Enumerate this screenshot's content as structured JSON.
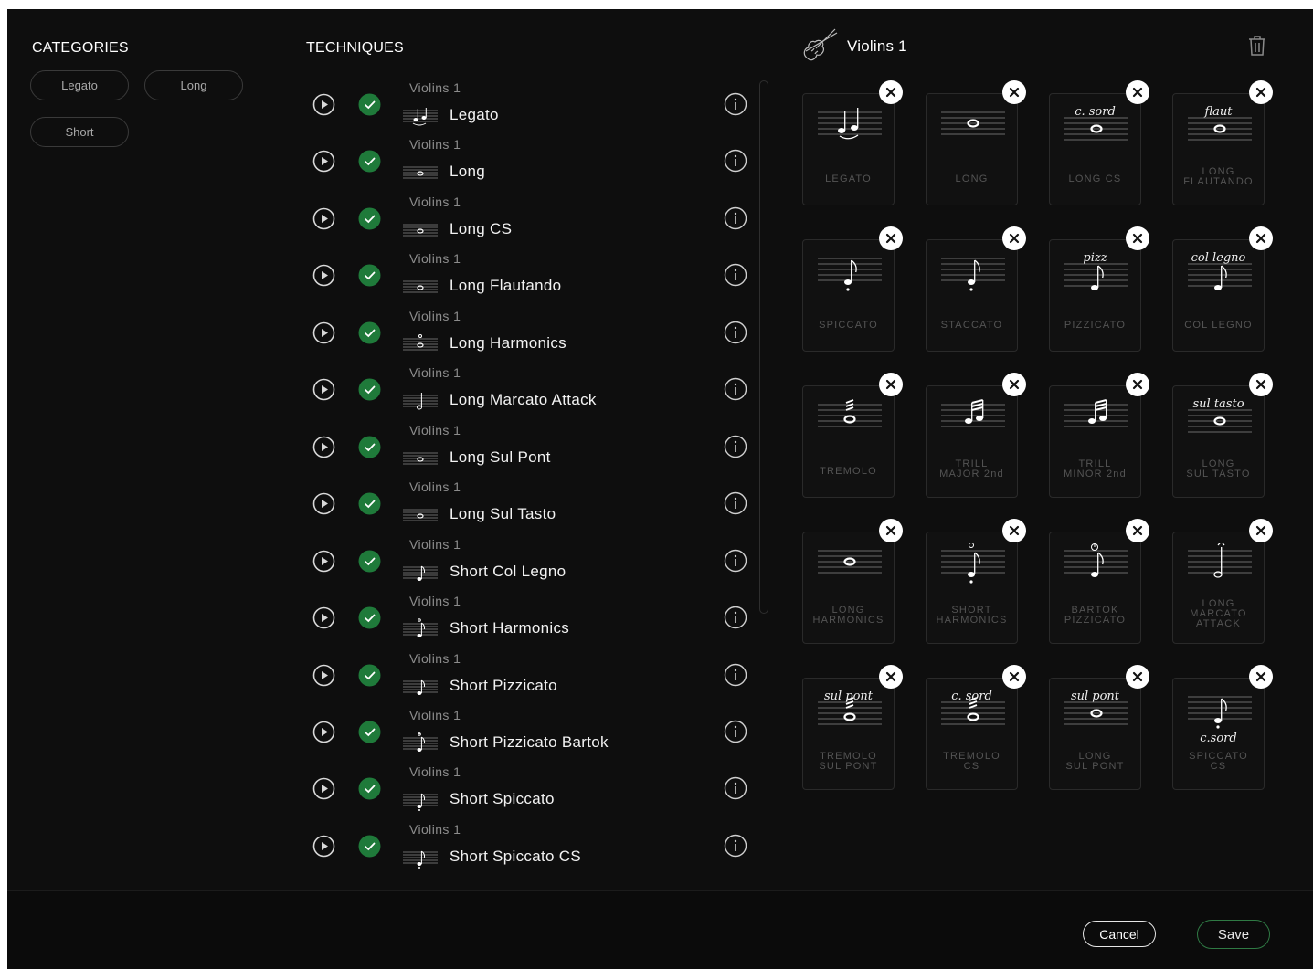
{
  "categories": {
    "title": "CATEGORIES",
    "items": [
      "Legato",
      "Long",
      "Short"
    ]
  },
  "techniques": {
    "title": "TECHNIQUES",
    "rows": [
      {
        "instrument": "Violins 1",
        "name": "Legato",
        "icon": "legato-notation-icon",
        "enabled": true
      },
      {
        "instrument": "Violins 1",
        "name": "Long",
        "icon": "whole-note-icon",
        "enabled": true
      },
      {
        "instrument": "Violins 1",
        "name": "Long CS",
        "icon": "con-sordino-whole-note-icon",
        "enabled": true
      },
      {
        "instrument": "Violins 1",
        "name": "Long Flautando",
        "icon": "flautando-whole-note-icon",
        "enabled": true
      },
      {
        "instrument": "Violins 1",
        "name": "Long Harmonics",
        "icon": "harmonic-whole-note-icon",
        "enabled": true
      },
      {
        "instrument": "Violins 1",
        "name": "Long Marcato Attack",
        "icon": "marcato-note-icon",
        "enabled": true
      },
      {
        "instrument": "Violins 1",
        "name": "Long Sul Pont",
        "icon": "sul-pont-whole-note-icon",
        "enabled": true
      },
      {
        "instrument": "Violins 1",
        "name": "Long Sul Tasto",
        "icon": "sul-tasto-whole-note-icon",
        "enabled": true
      },
      {
        "instrument": "Violins 1",
        "name": "Short Col Legno",
        "icon": "col-legno-eighth-note-icon",
        "enabled": true
      },
      {
        "instrument": "Violins 1",
        "name": "Short Harmonics",
        "icon": "harmonic-eighth-note-icon",
        "enabled": true
      },
      {
        "instrument": "Violins 1",
        "name": "Short Pizzicato",
        "icon": "pizz-eighth-note-icon",
        "enabled": true
      },
      {
        "instrument": "Violins 1",
        "name": "Short Pizzicato Bartok",
        "icon": "bartok-eighth-note-icon",
        "enabled": true
      },
      {
        "instrument": "Violins 1",
        "name": "Short Spiccato",
        "icon": "staccato-eighth-note-icon",
        "enabled": true
      },
      {
        "instrument": "Violins 1",
        "name": "Short Spiccato CS",
        "icon": "staccato-eighth-note-icon",
        "enabled": true
      }
    ]
  },
  "header": {
    "instrument": "Violins 1",
    "instrument_icon": "violin-icon",
    "delete_icon": "trash-icon"
  },
  "selected": {
    "cards": [
      {
        "label": "LEGATO",
        "mark": "",
        "glyph": "legato"
      },
      {
        "label": "LONG",
        "mark": "",
        "glyph": "whole"
      },
      {
        "label": "LONG CS",
        "mark": "c. sord",
        "glyph": "whole"
      },
      {
        "label": "LONG\nFLAUTANDO",
        "mark": "flaut",
        "glyph": "whole"
      },
      {
        "label": "SPICCATO",
        "mark": "",
        "glyph": "eighth-dot"
      },
      {
        "label": "STACCATO",
        "mark": "",
        "glyph": "eighth-dot"
      },
      {
        "label": "PIZZICATO",
        "mark": "pizz",
        "glyph": "eighth"
      },
      {
        "label": "COL LEGNO",
        "mark": "col legno",
        "glyph": "eighth"
      },
      {
        "label": "TREMOLO",
        "mark": "",
        "glyph": "tremolo"
      },
      {
        "label": "TRILL\nMAJOR 2nd",
        "mark": "",
        "glyph": "sixteenths"
      },
      {
        "label": "TRILL\nMINOR 2nd",
        "mark": "",
        "glyph": "sixteenths"
      },
      {
        "label": "LONG\nSUL TASTO",
        "mark": "sul tasto",
        "glyph": "whole"
      },
      {
        "label": "LONG\nHARMONICS",
        "mark": "",
        "glyph": "harmonic-whole"
      },
      {
        "label": "SHORT\nHARMONICS",
        "mark": "",
        "glyph": "harmonic-eighth"
      },
      {
        "label": "BARTOK\nPIZZICATO",
        "mark": "",
        "glyph": "bartok"
      },
      {
        "label": "LONG\nMARCATO\nATTACK",
        "mark": "",
        "glyph": "marcato"
      },
      {
        "label": "TREMOLO\nSUL PONT",
        "mark": "sul pont",
        "glyph": "tremolo"
      },
      {
        "label": "TREMOLO\nCS",
        "mark": "c. sord",
        "glyph": "tremolo"
      },
      {
        "label": "LONG\nSUL PONT",
        "mark": "sul pont",
        "glyph": "whole"
      },
      {
        "label": "SPICCATO\nCS",
        "mark": "c.sord",
        "glyph": "eighth-dot-below"
      }
    ]
  },
  "footer": {
    "cancel_label": "Cancel",
    "save_label": "Save"
  },
  "colors": {
    "background": "#0e0e0e",
    "check_green": "#1f7a3a",
    "save_border": "#2f7a44"
  }
}
